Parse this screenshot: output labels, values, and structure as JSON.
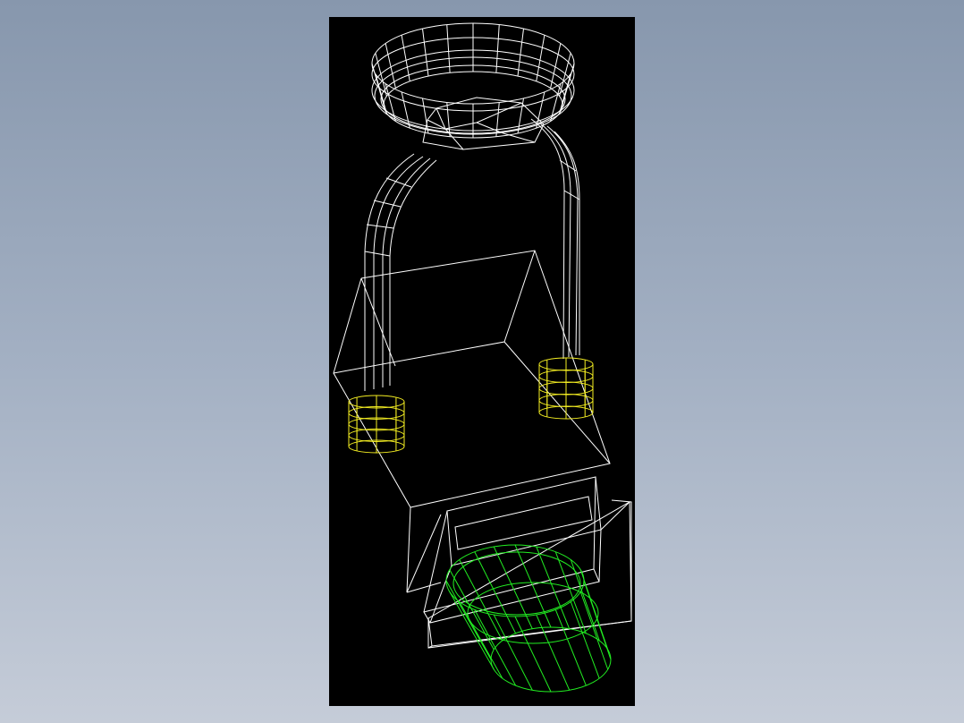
{
  "viewport": {
    "background": "#000000"
  },
  "colors": {
    "background_top": "#8797ad",
    "background_bottom": "#c5ccd8",
    "body_wireframe": "#ffffff",
    "mounts": "#f4ee22",
    "lens": "#22ee22"
  }
}
